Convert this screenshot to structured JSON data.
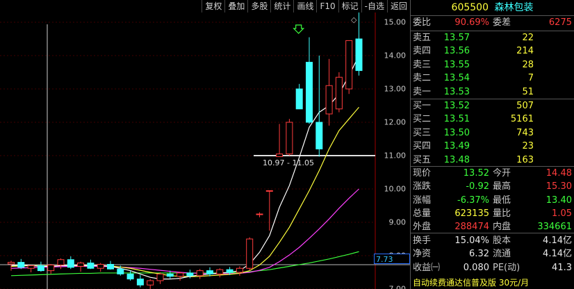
{
  "toolbar": {
    "buttons": [
      "复权",
      "叠加",
      "多股",
      "统计",
      "画线",
      "F10",
      "标记",
      "-自选",
      "返回"
    ],
    "menu_glyph": "◇"
  },
  "chart": {
    "y_ticks": [
      "15.00",
      "14.00",
      "13.00",
      "12.00",
      "11.00",
      "10.00",
      "9.00",
      "8.00",
      "7.00"
    ],
    "current_price_tag": "7.73",
    "high_annotation": "15.30",
    "range_annotation": "10.97 - 11.05",
    "colors": {
      "up": "#ff3c3c",
      "down": "#3cffff",
      "ma5": "#ffffff",
      "ma10": "#ffff3c",
      "ma20": "#ff40ff",
      "ma60": "#3cff3c",
      "support": "#ffffff"
    }
  },
  "chart_data": {
    "type": "candlestick",
    "ylim": [
      7.0,
      15.5
    ],
    "candles": [
      {
        "open": 7.75,
        "high": 7.85,
        "low": 7.55,
        "close": 7.8
      },
      {
        "open": 7.8,
        "high": 7.9,
        "low": 7.6,
        "close": 7.65
      },
      {
        "open": 7.62,
        "high": 7.72,
        "low": 7.5,
        "close": 7.7
      },
      {
        "open": 7.7,
        "high": 7.82,
        "low": 7.52,
        "close": 7.55
      },
      {
        "open": 7.55,
        "high": 7.75,
        "low": 7.45,
        "close": 7.72
      },
      {
        "open": 7.72,
        "high": 7.92,
        "low": 7.6,
        "close": 7.88
      },
      {
        "open": 7.88,
        "high": 7.98,
        "low": 7.6,
        "close": 7.65
      },
      {
        "open": 7.68,
        "high": 7.82,
        "low": 7.52,
        "close": 7.78
      },
      {
        "open": 7.78,
        "high": 7.88,
        "low": 7.6,
        "close": 7.62
      },
      {
        "open": 7.62,
        "high": 7.78,
        "low": 7.52,
        "close": 7.74
      },
      {
        "open": 7.74,
        "high": 7.84,
        "low": 7.58,
        "close": 7.6
      },
      {
        "open": 7.6,
        "high": 7.7,
        "low": 7.4,
        "close": 7.45
      },
      {
        "open": 7.45,
        "high": 7.55,
        "low": 7.25,
        "close": 7.3
      },
      {
        "open": 7.3,
        "high": 7.42,
        "low": 7.05,
        "close": 7.12
      },
      {
        "open": 7.12,
        "high": 7.3,
        "low": 6.95,
        "close": 7.25
      },
      {
        "open": 7.25,
        "high": 7.5,
        "low": 7.15,
        "close": 7.45
      },
      {
        "open": 7.45,
        "high": 7.55,
        "low": 7.3,
        "close": 7.38
      },
      {
        "open": 7.38,
        "high": 7.52,
        "low": 7.25,
        "close": 7.48
      },
      {
        "open": 7.48,
        "high": 7.58,
        "low": 7.32,
        "close": 7.4
      },
      {
        "open": 7.4,
        "high": 7.6,
        "low": 7.3,
        "close": 7.55
      },
      {
        "open": 7.55,
        "high": 7.65,
        "low": 7.38,
        "close": 7.45
      },
      {
        "open": 7.45,
        "high": 7.62,
        "low": 7.35,
        "close": 7.58
      },
      {
        "open": 7.58,
        "high": 7.66,
        "low": 7.42,
        "close": 7.5
      },
      {
        "open": 7.5,
        "high": 7.68,
        "low": 7.4,
        "close": 7.62
      },
      {
        "open": 7.62,
        "high": 8.55,
        "low": 7.55,
        "close": 8.5
      },
      {
        "open": 9.25,
        "high": 9.3,
        "low": 9.15,
        "close": 9.25
      },
      {
        "open": 9.95,
        "high": 9.95,
        "low": 8.75,
        "close": 9.95
      },
      {
        "open": 10.97,
        "high": 11.95,
        "low": 10.97,
        "close": 11.05
      },
      {
        "open": 11.05,
        "high": 12.1,
        "low": 11.0,
        "close": 12.0
      },
      {
        "open": 13.0,
        "high": 13.15,
        "low": 12.4,
        "close": 12.4
      },
      {
        "open": 13.8,
        "high": 14.55,
        "low": 11.95,
        "close": 12.0
      },
      {
        "open": 12.0,
        "high": 14.0,
        "low": 10.97,
        "close": 11.2
      },
      {
        "open": 12.25,
        "high": 13.9,
        "low": 11.9,
        "close": 13.1
      },
      {
        "open": 12.4,
        "high": 13.5,
        "low": 12.3,
        "close": 13.35
      },
      {
        "open": 13.0,
        "high": 14.25,
        "low": 12.85,
        "close": 14.45
      },
      {
        "open": 14.5,
        "high": 15.3,
        "low": 13.4,
        "close": 13.55
      }
    ],
    "ma5": [
      7.7,
      7.72,
      7.7,
      7.68,
      7.68,
      7.7,
      7.7,
      7.72,
      7.7,
      7.7,
      7.68,
      7.62,
      7.55,
      7.45,
      7.35,
      7.3,
      7.3,
      7.32,
      7.38,
      7.42,
      7.45,
      7.48,
      7.5,
      7.55,
      7.75,
      8.1,
      8.6,
      9.45,
      10.1,
      10.95,
      11.85,
      12.3,
      12.5,
      12.85,
      13.4,
      14.0
    ],
    "ma10": [
      7.68,
      7.69,
      7.7,
      7.7,
      7.69,
      7.7,
      7.7,
      7.7,
      7.7,
      7.7,
      7.69,
      7.66,
      7.62,
      7.56,
      7.5,
      7.45,
      7.4,
      7.38,
      7.37,
      7.38,
      7.4,
      7.42,
      7.44,
      7.47,
      7.55,
      7.72,
      7.98,
      8.4,
      8.85,
      9.4,
      9.95,
      10.55,
      11.2,
      11.75,
      12.1,
      12.45
    ],
    "ma20": [
      7.62,
      7.63,
      7.64,
      7.65,
      7.66,
      7.67,
      7.68,
      7.68,
      7.68,
      7.68,
      7.67,
      7.66,
      7.64,
      7.62,
      7.59,
      7.56,
      7.53,
      7.5,
      7.48,
      7.47,
      7.46,
      7.46,
      7.46,
      7.47,
      7.5,
      7.56,
      7.65,
      7.82,
      8.02,
      8.25,
      8.52,
      8.8,
      9.1,
      9.42,
      9.72,
      10.0
    ],
    "ma60": [
      7.4,
      7.41,
      7.42,
      7.43,
      7.44,
      7.45,
      7.46,
      7.47,
      7.47,
      7.48,
      7.48,
      7.48,
      7.48,
      7.48,
      7.48,
      7.48,
      7.48,
      7.48,
      7.48,
      7.48,
      7.48,
      7.48,
      7.49,
      7.5,
      7.52,
      7.55,
      7.58,
      7.63,
      7.68,
      7.73,
      7.78,
      7.84,
      7.9,
      7.97,
      8.04,
      8.12
    ],
    "support_level": 11.0
  },
  "panel": {
    "code": "605500",
    "name": "森林包装",
    "weibi": {
      "label": "委比",
      "value": "90.69%",
      "label2": "委差",
      "value2": "6275"
    },
    "asks": [
      {
        "label": "卖五",
        "price": "13.57",
        "vol": "22"
      },
      {
        "label": "卖四",
        "price": "13.56",
        "vol": "214"
      },
      {
        "label": "卖三",
        "price": "13.55",
        "vol": "28"
      },
      {
        "label": "卖二",
        "price": "13.54",
        "vol": "7"
      },
      {
        "label": "卖一",
        "price": "13.53",
        "vol": "51"
      }
    ],
    "bids": [
      {
        "label": "买一",
        "price": "13.52",
        "vol": "507"
      },
      {
        "label": "买二",
        "price": "13.51",
        "vol": "5161"
      },
      {
        "label": "买三",
        "price": "13.50",
        "vol": "743"
      },
      {
        "label": "买四",
        "price": "13.49",
        "vol": "23"
      },
      {
        "label": "买五",
        "price": "13.48",
        "vol": "163"
      }
    ],
    "stats": [
      {
        "l1": "现价",
        "v1": "13.52",
        "c1": "green",
        "l2": "今开",
        "v2": "14.48",
        "c2": "red"
      },
      {
        "l1": "涨跌",
        "v1": "-0.92",
        "c1": "green",
        "l2": "最高",
        "v2": "15.30",
        "c2": "red"
      },
      {
        "l1": "涨幅",
        "v1": "-6.37%",
        "c1": "green",
        "l2": "最低",
        "v2": "13.40",
        "c2": "green"
      },
      {
        "l1": "总量",
        "v1": "623135",
        "c1": "yellow",
        "l2": "量比",
        "v2": "1.05",
        "c2": "red"
      },
      {
        "l1": "外盘",
        "v1": "288474",
        "c1": "red",
        "l2": "内盘",
        "v2": "334661",
        "c2": "green"
      }
    ],
    "fin": [
      {
        "l1": "换手",
        "v1": "15.04%",
        "l2": "股本",
        "v2": "4.14亿"
      },
      {
        "l1": "净资",
        "v1": "6.32",
        "l2": "流通",
        "v2": "4.14亿"
      },
      {
        "l1": "收益㈠",
        "v1": "0.080",
        "l2": "PE(动)",
        "v2": "41.3"
      }
    ],
    "promo": "自动续费通达信普及版  30元/月"
  }
}
